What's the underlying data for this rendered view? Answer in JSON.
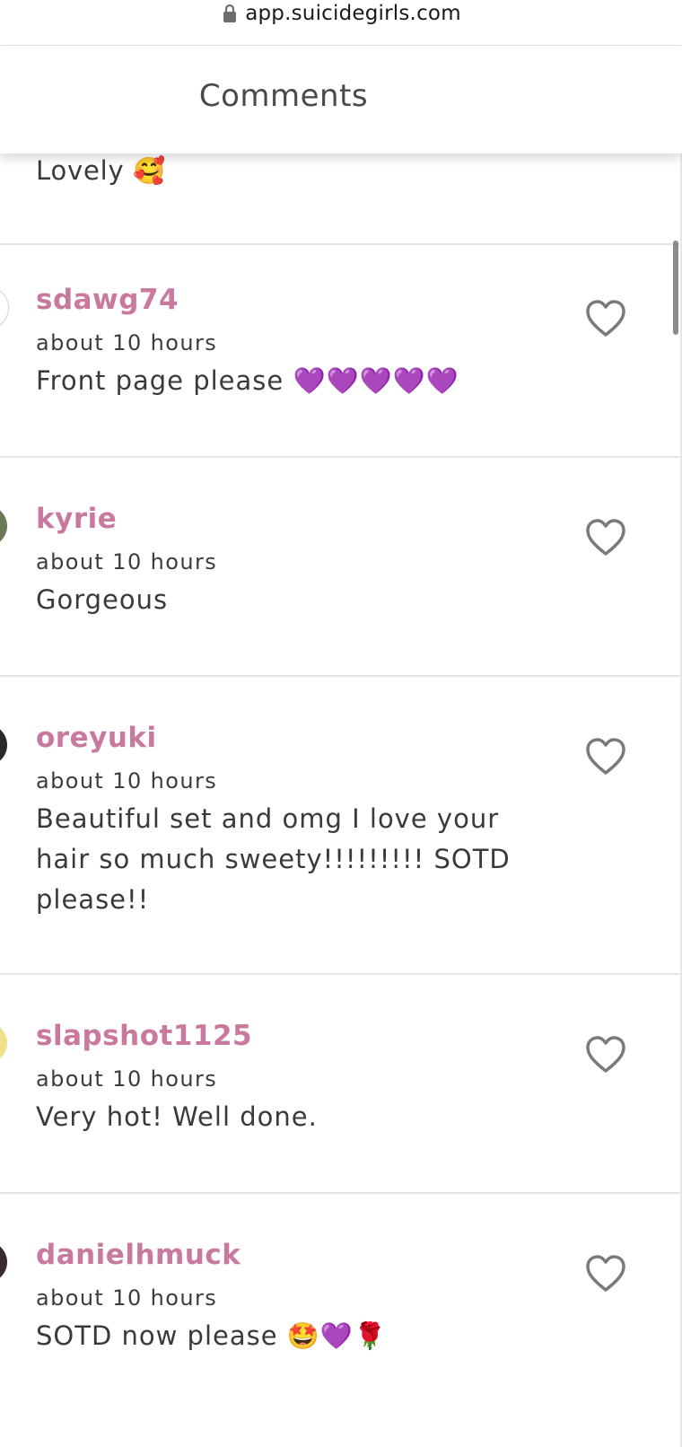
{
  "browser": {
    "url": "app.suicidegirls.com"
  },
  "header": {
    "title": "Comments"
  },
  "partial_comment": {
    "text": "Lovely 🥰"
  },
  "comments": [
    {
      "username": "sdawg74",
      "time": "about 10 hours",
      "text": "Front page please 💜💜💜💜💜",
      "avatar_color": "#f4f4f4"
    },
    {
      "username": "kyrie",
      "time": "about 10 hours",
      "text": "Gorgeous",
      "avatar_color": "#6b7a55"
    },
    {
      "username": "oreyuki",
      "time": "about 10 hours",
      "text": "Beautiful set and omg I love your hair so much sweety!!!!!!!!! SOTD please!!",
      "avatar_color": "#2a2a2a"
    },
    {
      "username": "slapshot1125",
      "time": "about 10 hours",
      "text": "Very hot! Well done.",
      "avatar_color": "#efe08a"
    },
    {
      "username": "danielhmuck",
      "time": "about 10 hours",
      "text": "SOTD now please 🤩💜🌹",
      "avatar_color": "#3a2a2a"
    }
  ],
  "colors": {
    "username": "#c9799d",
    "heart": "#7a7a7a",
    "divider": "#e4e4e4"
  },
  "icons": {
    "lock": "lock-icon",
    "like": "heart-outline-icon"
  }
}
